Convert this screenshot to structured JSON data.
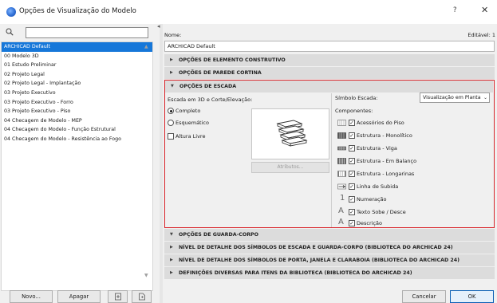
{
  "window": {
    "title": "Opções de Visualização do Modelo",
    "help": "?",
    "close": "✕"
  },
  "colors": {
    "selection": "#1677d9",
    "highlight_border": "#d9252b",
    "section_bg": "#dcdcdc"
  },
  "icons": {
    "app": "archicad-app-icon",
    "search": "search-icon",
    "new_folder": "new-folder-icon",
    "import": "import-icon"
  },
  "search": {
    "value": "",
    "placeholder": ""
  },
  "presets": [
    "ARCHICAD Default",
    "00 Modelo 3D",
    "01 Estudo Preliminar",
    "02 Projeto Legal",
    "02 Projeto Legal - Implantação",
    "03 Projeto Executivo",
    "03 Projeto Executivo - Forro",
    "03 Projeto Executivo - Piso",
    "04 Checagem de Modelo - MEP",
    "04 Checagem do Modelo - Função Estrutural",
    "04 Checagem do Modelo - Resistência ao Fogo"
  ],
  "selected_preset": "ARCHICAD Default",
  "left_buttons": {
    "new": "Novo...",
    "delete": "Apagar"
  },
  "name": {
    "label": "Nome:",
    "value": "ARCHICAD Default",
    "editable": "Editável: 1"
  },
  "sections": {
    "element": "OPÇÕES DE ELEMENTO CONSTRUTIVO",
    "curtain": "OPÇÕES DE PAREDE CORTINA",
    "stair": "OPÇÕES DE ESCADA",
    "railing": "OPÇÕES DE GUARDA-CORPO",
    "stair_detail": "NÍVEL DE DETALHE DOS SÍMBOLOS DE ESCADA E GUARDA-CORPO (BIBLIOTECA DO ARCHICAD 24)",
    "door_detail": "NÍVEL DE DETALHE DOS SÍMBOLOS DE PORTA, JANELA E CLARABOIA (BIBLIOTECA DO ARCHICAD 24)",
    "misc": "DEFINIÇÕES DIVERSAS PARA ITENS DA BIBLIOTECA (BIBLIOTECA DO ARCHICAD 24)"
  },
  "stair": {
    "view_label": "Escada em 3D e Corte/Elevação:",
    "complete": "Completo",
    "schematic": "Esquemático",
    "headroom": "Altura Livre",
    "attributes_btn": "Atributos...",
    "symbol_label": "Símbolo Escada:",
    "symbol_value": "Visualização em Planta",
    "components_label": "Componentes:",
    "components": [
      "Acessórios do Piso",
      "Estrutura - Monolítico",
      "Estrutura - Viga",
      "Estrutura - Em Balanço",
      "Estrutura - Longarinas",
      "Linha de Subida",
      "Numeração",
      "Texto Sobe / Desce",
      "Descrição"
    ],
    "number_glyph": "1",
    "text_glyph": "A"
  },
  "footer": {
    "cancel": "Cancelar",
    "ok": "OK"
  }
}
